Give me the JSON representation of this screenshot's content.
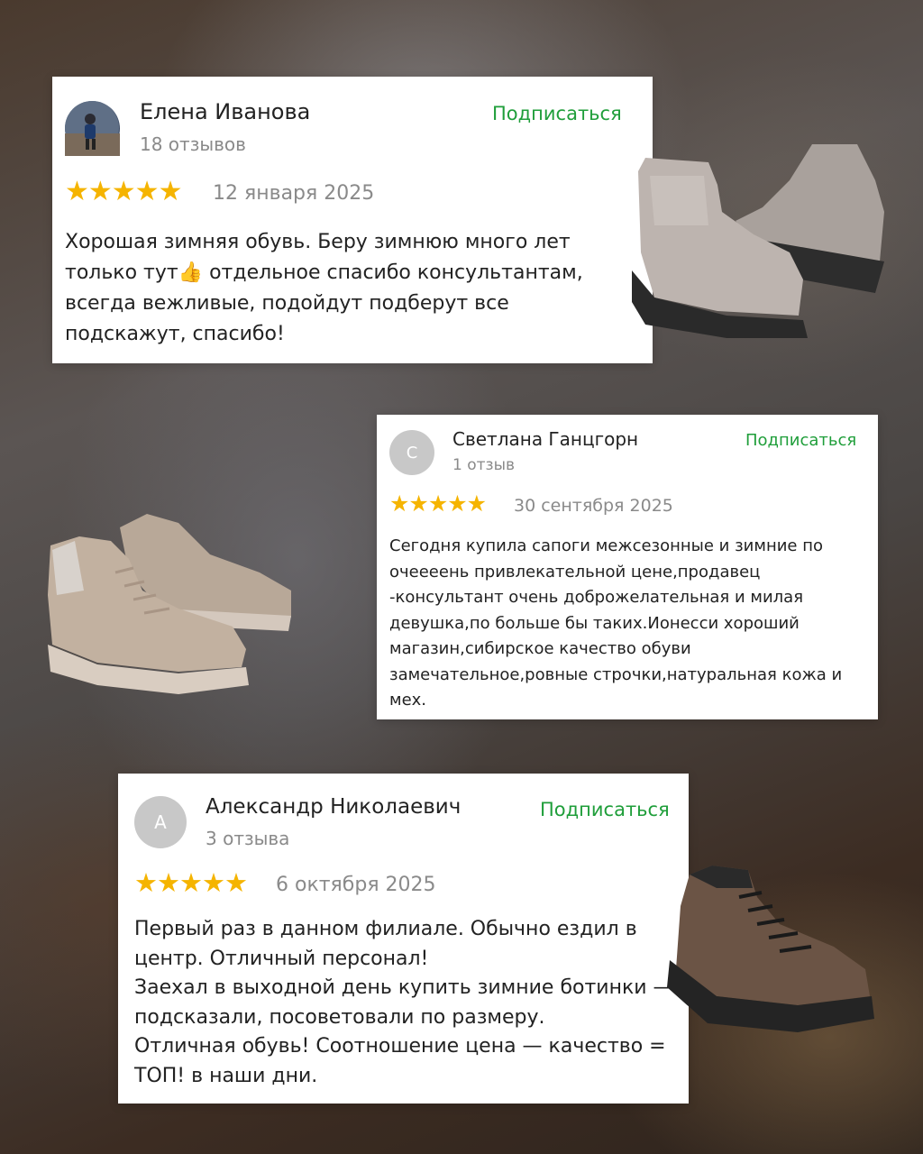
{
  "reviews": [
    {
      "name": "Елена Иванова",
      "count": "18 отзывов",
      "subscribe": "Подписаться",
      "rating": 5,
      "stars": "★★★★★",
      "date": "12 января 2025",
      "text": "Хорошая зимняя обувь. Беру зимнюю много лет только тут👍 отдельное спасибо консультантам, всегда вежливые, подойдут подберут все подскажут, спасибо!",
      "avatar": "photo"
    },
    {
      "name": "Светлана Ганцгорн",
      "count": "1 отзыв",
      "subscribe": "Подписаться",
      "rating": 5,
      "stars": "★★★★★",
      "date": "30 сентября 2025",
      "text": "Сегодня купила сапоги межсезонные и зимние по очеееень привлекательной цене,продавец -консультант очень доброжелательная и милая девушка,по больше бы таких.Ионесси хороший магазин,сибирское качество обуви замечательное,ровные строчки,натуральная кожа и мех.",
      "avatar": "С"
    },
    {
      "name": "Александр Николаевич",
      "count": "3 отзыва",
      "subscribe": "Подписаться",
      "rating": 5,
      "stars": "★★★★★",
      "date": "6 октября 2025",
      "text": "Первый раз в данном филиале. Обычно ездил в центр. Отличный персонал!\nЗаехал в выходной день купить зимние ботинки — подсказали, посоветовали по размеру.\nОтличная обувь! Соотношение цена — качество = ТОП! в наши дни.",
      "avatar": "А"
    }
  ],
  "colors": {
    "accent_green": "#1f9e3a",
    "star": "#f5b400",
    "avatar_gray": "#c8c8c8"
  },
  "icons": [
    "star-icon",
    "grey-ankle-boots-image",
    "beige-sneaker-boots-image",
    "brown-high-top-image"
  ]
}
